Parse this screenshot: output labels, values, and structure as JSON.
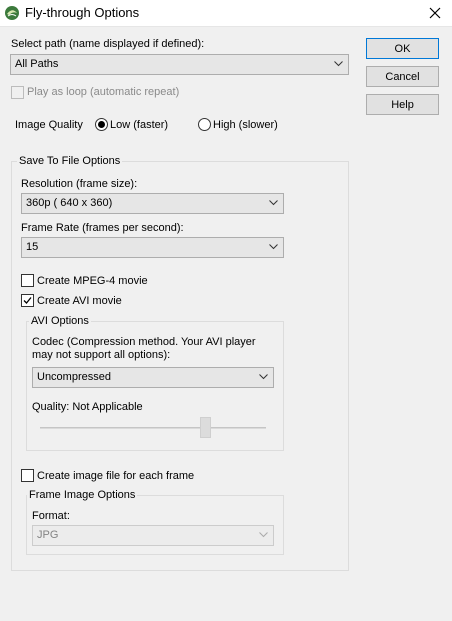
{
  "window": {
    "title": "Fly-through Options"
  },
  "path": {
    "label": "Select path (name displayed if defined):",
    "value": "All Paths"
  },
  "loop": {
    "label": "Play as loop (automatic repeat)"
  },
  "quality": {
    "label": "Image Quality",
    "low_label": "Low (faster)",
    "high_label": "High (slower)",
    "selected": "low"
  },
  "buttons": {
    "ok": "OK",
    "cancel": "Cancel",
    "help": "Help"
  },
  "save_group": {
    "title": "Save To File Options",
    "resolution_label": "Resolution (frame size):",
    "resolution_value": "360p ( 640 x  360)",
    "framerate_label": "Frame Rate (frames per second):",
    "framerate_value": "15",
    "mpeg_label": "Create MPEG-4 movie",
    "avi_label": "Create AVI movie",
    "image_label": "Create image file for each frame"
  },
  "avi_group": {
    "title": "AVI Options",
    "codec_label_line1": "Codec (Compression method. Your AVI player",
    "codec_label_line2": "may not support all options):",
    "codec_value": "Uncompressed",
    "quality_label": "Quality: Not Applicable"
  },
  "frame_group": {
    "title": "Frame Image Options",
    "format_label": "Format:",
    "format_value": "JPG"
  },
  "colors": {
    "accent": "#0078d7",
    "disabled_text": "#8a8a8a"
  }
}
